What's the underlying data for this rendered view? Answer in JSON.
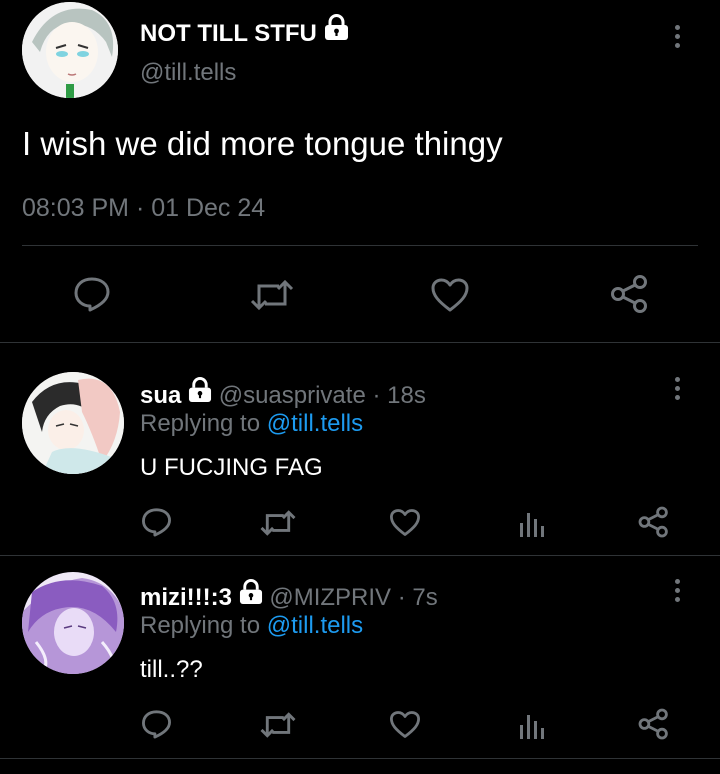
{
  "main_tweet": {
    "display_name": "NOT TILL STFU",
    "handle": "@till.tells",
    "text": "I wish we did more tongue thingy",
    "timestamp": "08:03 PM · 01 Dec 24",
    "icons": [
      "lock-icon",
      "more-icon",
      "reply-icon",
      "retweet-icon",
      "like-icon",
      "share-icon"
    ]
  },
  "replies": [
    {
      "display_name": "sua",
      "handle": "@suasprivate",
      "time": "· 18s",
      "replying_prefix": "Replying to",
      "replying_handle": "@till.tells",
      "text": "U FUCJING FAG"
    },
    {
      "display_name": "mizi!!!:3",
      "handle": "@MIZPRIV",
      "time": "· 7s",
      "replying_prefix": "Replying to",
      "replying_handle": "@till.tells",
      "text": "till..??"
    }
  ],
  "colors": {
    "background": "#000000",
    "text": "#e7e9ea",
    "muted": "#71767b",
    "link": "#1d9bf0",
    "divider": "#2f3336"
  }
}
